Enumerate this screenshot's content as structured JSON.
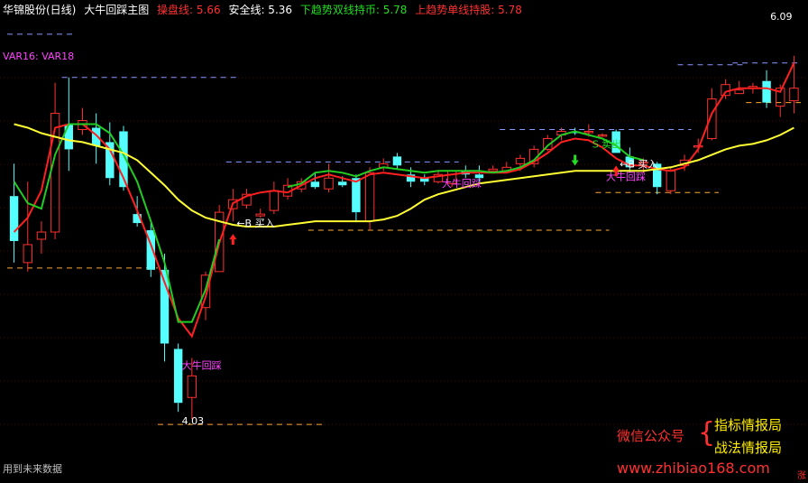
{
  "header": {
    "stock_name": "华锦股份(日线)",
    "indicator_name": "大牛回踩主图",
    "items": [
      {
        "label": "操盘线: 5.66",
        "color": "#ff3030"
      },
      {
        "label": "安全线: 5.36",
        "color": "#ffffff"
      },
      {
        "label": "下趋势双线持币: 5.78",
        "color": "#22dd22"
      },
      {
        "label": "上趋势单线持股: 5.78",
        "color": "#ff3030"
      }
    ]
  },
  "var_label": "VAR16: VAR18",
  "footer_note": "用到未来数据",
  "watermark": {
    "wechat": "微信公众号",
    "brace": "{",
    "line1": "指标情报局",
    "line2": "战法情报局",
    "url": "www.zhibiao168.com",
    "corner": "涨"
  },
  "chart_data": {
    "type": "candlestick",
    "ylim": [
      3.9,
      6.3
    ],
    "up_color": "#ff3030",
    "down_color": "#55ffff",
    "candles": [
      [
        5.32,
        5.5,
        4.95,
        5.07
      ],
      [
        4.95,
        5.4,
        4.9,
        5.05
      ],
      [
        5.08,
        5.18,
        5.0,
        5.12
      ],
      [
        5.12,
        5.95,
        5.08,
        5.78
      ],
      [
        5.72,
        5.98,
        5.46,
        5.58
      ],
      [
        5.69,
        5.81,
        5.66,
        5.74
      ],
      [
        5.7,
        5.78,
        5.5,
        5.6
      ],
      [
        5.62,
        5.73,
        5.38,
        5.42
      ],
      [
        5.68,
        5.71,
        5.35,
        5.37
      ],
      [
        5.22,
        5.32,
        5.15,
        5.17
      ],
      [
        5.13,
        5.17,
        4.87,
        4.91
      ],
      [
        4.91,
        5.0,
        4.4,
        4.5
      ],
      [
        4.47,
        4.5,
        4.12,
        4.17
      ],
      [
        4.2,
        4.42,
        4.08,
        4.32
      ],
      [
        4.7,
        4.9,
        4.63,
        4.88
      ],
      [
        4.9,
        5.27,
        4.9,
        5.23
      ],
      [
        5.25,
        5.36,
        5.18,
        5.3
      ],
      [
        5.27,
        5.36,
        5.25,
        5.33
      ],
      [
        5.21,
        5.25,
        5.2,
        5.22
      ],
      [
        5.24,
        5.4,
        5.22,
        5.35
      ],
      [
        5.32,
        5.42,
        5.3,
        5.38
      ],
      [
        5.36,
        5.42,
        5.34,
        5.4
      ],
      [
        5.4,
        5.45,
        5.36,
        5.37
      ],
      [
        5.36,
        5.5,
        5.34,
        5.42
      ],
      [
        5.4,
        5.43,
        5.37,
        5.38
      ],
      [
        5.42,
        5.44,
        5.18,
        5.23
      ],
      [
        5.18,
        5.48,
        5.13,
        5.45
      ],
      [
        5.48,
        5.53,
        5.46,
        5.5
      ],
      [
        5.54,
        5.56,
        5.47,
        5.49
      ],
      [
        5.44,
        5.48,
        5.37,
        5.4
      ],
      [
        5.42,
        5.44,
        5.38,
        5.4
      ],
      [
        5.4,
        5.46,
        5.39,
        5.44
      ],
      [
        5.39,
        5.46,
        5.37,
        5.46
      ],
      [
        5.46,
        5.49,
        5.42,
        5.44
      ],
      [
        5.44,
        5.49,
        5.4,
        5.42
      ],
      [
        5.46,
        5.49,
        5.45,
        5.47
      ],
      [
        5.46,
        5.51,
        5.45,
        5.48
      ],
      [
        5.5,
        5.55,
        5.46,
        5.53
      ],
      [
        5.5,
        5.6,
        5.48,
        5.58
      ],
      [
        5.58,
        5.66,
        5.57,
        5.64
      ],
      [
        5.66,
        5.7,
        5.63,
        5.68
      ],
      [
        5.68,
        5.7,
        5.66,
        5.67
      ],
      [
        5.68,
        5.72,
        5.65,
        5.68
      ],
      [
        5.66,
        5.67,
        5.65,
        5.66
      ],
      [
        5.68,
        5.69,
        5.56,
        5.56
      ],
      [
        5.54,
        5.59,
        5.45,
        5.48
      ],
      [
        5.51,
        5.53,
        5.45,
        5.51
      ],
      [
        5.5,
        5.51,
        5.33,
        5.37
      ],
      [
        5.35,
        5.48,
        5.33,
        5.46
      ],
      [
        5.49,
        5.55,
        5.46,
        5.52
      ],
      [
        5.6,
        5.64,
        5.56,
        5.6
      ],
      [
        5.64,
        5.92,
        5.63,
        5.86
      ],
      [
        5.88,
        5.97,
        5.86,
        5.94
      ],
      [
        5.89,
        5.96,
        5.89,
        5.91
      ],
      [
        5.92,
        5.95,
        5.89,
        5.93
      ],
      [
        5.96,
        6.02,
        5.81,
        5.84
      ],
      [
        5.82,
        5.94,
        5.76,
        5.92
      ],
      [
        5.85,
        6.1,
        5.78,
        5.92
      ]
    ],
    "lines": [
      {
        "name": "操盘线",
        "color": "#ff2020",
        "values": [
          5.12,
          5.2,
          5.35,
          5.7,
          5.72,
          5.72,
          5.66,
          5.58,
          5.42,
          5.24,
          5.05,
          4.84,
          4.64,
          4.54,
          4.76,
          5.06,
          5.28,
          5.32,
          5.34,
          5.35,
          5.34,
          5.38,
          5.42,
          5.44,
          5.42,
          5.4,
          5.44,
          5.45,
          5.44,
          5.43,
          5.42,
          5.43,
          5.44,
          5.45,
          5.45,
          5.45,
          5.45,
          5.47,
          5.51,
          5.56,
          5.62,
          5.64,
          5.63,
          5.59,
          5.53,
          5.49,
          5.49,
          5.47,
          5.46,
          5.48,
          5.58,
          5.78,
          5.9,
          5.92,
          5.92,
          5.92,
          5.9,
          6.06
        ]
      },
      {
        "name": "下趋势双线持币",
        "color": "#22cc22",
        "values": [
          5.4,
          5.28,
          5.25,
          5.55,
          5.72,
          5.72,
          5.72,
          5.67,
          5.55,
          5.4,
          5.18,
          4.95,
          4.62,
          4.62,
          4.8,
          5.08,
          null,
          null,
          null,
          null,
          5.37,
          5.39,
          5.45,
          5.46,
          5.45,
          5.43,
          5.46,
          5.48,
          5.47,
          5.46,
          5.45,
          5.46,
          5.46,
          5.46,
          5.46,
          5.45,
          5.46,
          5.48,
          5.52,
          5.6,
          5.66,
          5.68,
          5.66,
          5.64,
          5.6,
          5.54,
          5.52,
          null,
          null,
          null,
          null,
          null,
          null,
          null,
          null,
          null,
          null,
          null
        ]
      },
      {
        "name": "安全线",
        "color": "#ffff33",
        "values": [
          5.72,
          5.7,
          5.67,
          5.65,
          5.63,
          5.62,
          5.6,
          5.58,
          5.56,
          5.52,
          5.45,
          5.38,
          5.3,
          5.24,
          5.2,
          5.18,
          5.16,
          5.15,
          5.15,
          5.15,
          5.16,
          5.17,
          5.18,
          5.18,
          5.18,
          5.18,
          5.18,
          5.19,
          5.21,
          5.25,
          5.3,
          5.33,
          5.35,
          5.37,
          5.39,
          5.4,
          5.41,
          5.42,
          5.43,
          5.44,
          5.45,
          5.46,
          5.46,
          5.46,
          5.46,
          5.46,
          5.46,
          5.47,
          5.48,
          5.5,
          5.52,
          5.55,
          5.58,
          5.6,
          5.61,
          5.63,
          5.66,
          5.7
        ]
      }
    ],
    "levels": [
      {
        "y": 5.98,
        "from": 4,
        "to": 16,
        "color": "#8899ff"
      },
      {
        "y": 5.51,
        "from": 16,
        "to": 32,
        "color": "#8899ff"
      },
      {
        "y": 5.69,
        "from": 36,
        "to": 49,
        "color": "#8899ff"
      },
      {
        "y": 6.05,
        "from": 49,
        "to": 53,
        "color": "#8899ff"
      },
      {
        "y": 6.06,
        "from": 53,
        "to": 57,
        "color": "#8899ff"
      },
      {
        "y": 6.22,
        "from": 0,
        "to": 4,
        "color": "#8899ff"
      },
      {
        "y": 4.92,
        "from": 0,
        "to": 10,
        "color": "#ffaa33"
      },
      {
        "y": 4.05,
        "from": 11,
        "to": 22,
        "color": "#ffaa33"
      },
      {
        "y": 5.13,
        "from": 22,
        "to": 43,
        "color": "#ffaa33"
      },
      {
        "y": 5.34,
        "from": 43,
        "to": 51,
        "color": "#ffaa33"
      },
      {
        "y": 5.84,
        "from": 54,
        "to": 57,
        "color": "#ffaa33"
      }
    ],
    "annotations": [
      {
        "text": "←B 买入",
        "i": 16,
        "y": 5.15,
        "color": "#ffffff"
      },
      {
        "text": "←B 买入",
        "i": 44,
        "y": 5.48,
        "color": "#ffffff"
      },
      {
        "text": "S 卖出",
        "i": 42,
        "y": 5.59,
        "color": "#22dd22"
      },
      {
        "text": "大牛回踩",
        "i": 12,
        "y": 4.36,
        "color": "#ff44ff"
      },
      {
        "text": "大牛回踩",
        "i": 31,
        "y": 5.37,
        "color": "#ff44ff"
      },
      {
        "text": "大牛回踩",
        "i": 43,
        "y": 5.41,
        "color": "#ff44ff"
      },
      {
        "text": "6.09",
        "i": 55,
        "y": 6.3,
        "color": "#ffffff"
      },
      {
        "text": "4.03",
        "i": 12,
        "y": 4.05,
        "color": "#ffffff"
      }
    ],
    "up_arrows": [
      16,
      44
    ],
    "down_arrows": [
      41
    ]
  }
}
